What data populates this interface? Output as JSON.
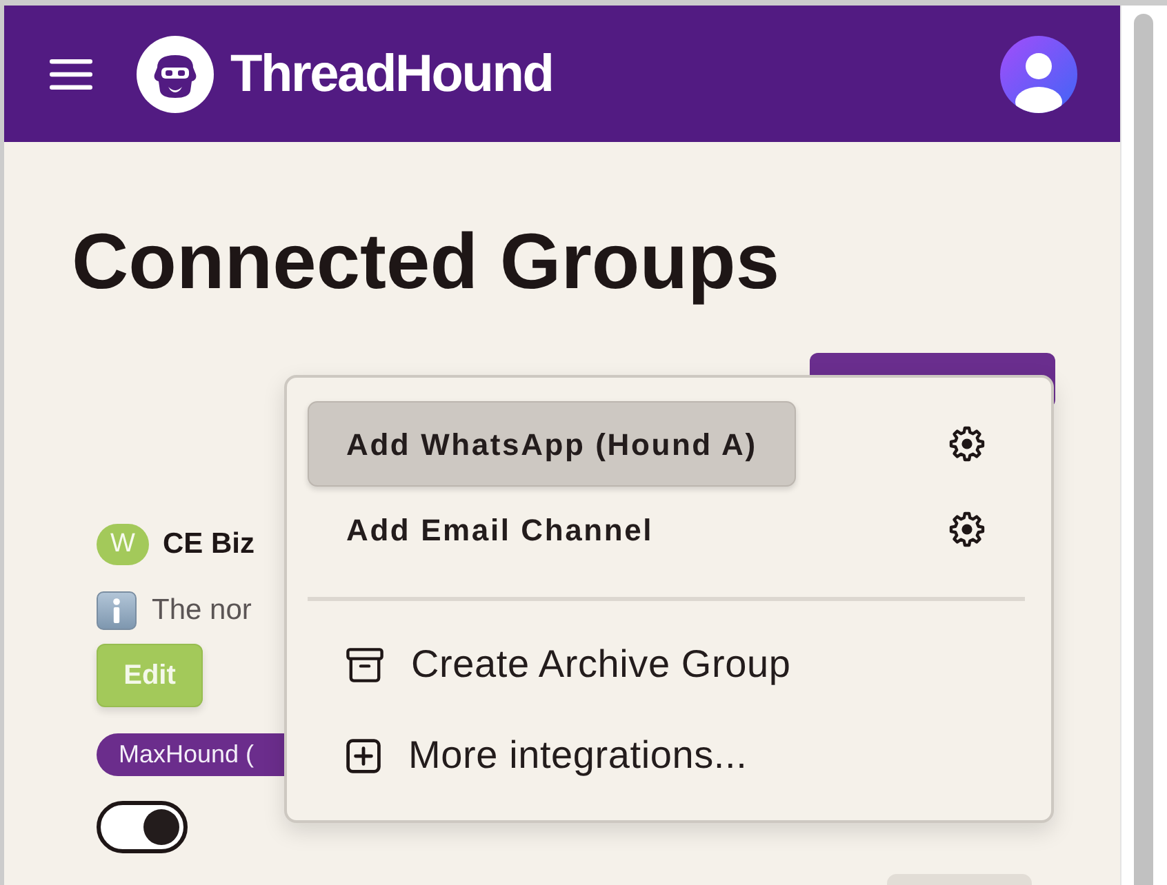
{
  "navbar": {
    "brand": "ThreadHound"
  },
  "page": {
    "title": "Connected Groups"
  },
  "group": {
    "badge": "W",
    "name": "CE Biz",
    "note": "The nor",
    "edit_button": "Edit",
    "tag": "MaxHound (",
    "toggle": {
      "on": true
    }
  },
  "menu": {
    "items": [
      {
        "kind": "channel",
        "label": "Add WhatsApp (Hound A)",
        "selected": true
      },
      {
        "kind": "channel",
        "label": "Add Email Channel",
        "selected": false
      },
      {
        "kind": "divider"
      },
      {
        "kind": "archive",
        "label": "Create Archive Group",
        "selected": false
      },
      {
        "kind": "add",
        "label": "More integrations...",
        "selected": false
      }
    ]
  }
}
